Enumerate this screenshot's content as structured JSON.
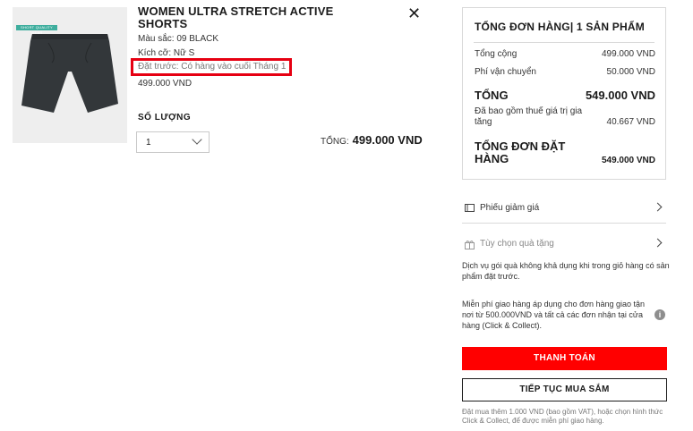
{
  "product": {
    "image_badge": "SHORT QUALITY WEAR",
    "title": "WOMEN ULTRA STRETCH ACTIVE SHORTS",
    "color": "Màu sắc: 09 BLACK",
    "size": "Kích cỡ: Nữ S",
    "preorder": "Đặt trước: Có hàng vào cuối Tháng 1",
    "price": "499.000 VND",
    "qty_label": "SỐ LƯỢNG",
    "qty_value": "1",
    "total_label": "TỔNG:",
    "total_value": "499.000 VND",
    "highlight_color": "#e60012"
  },
  "summary": {
    "heading": "TỔNG ĐƠN HÀNG| 1 SẢN PHẨM",
    "subtotal_label": "Tổng cộng",
    "subtotal_value": "499.000 VND",
    "shipping_label": "Phí vận chuyển",
    "shipping_value": "50.000 VND",
    "total_label": "TỔNG",
    "total_value": "549.000 VND",
    "vat_label": "Đã bao gồm thuế giá trị gia tăng",
    "vat_value": "40.667 VND",
    "order_total_label": "TỔNG ĐƠN ĐẶT HÀNG",
    "order_total_value": "549.000 VND"
  },
  "options": {
    "coupon": "Phiếu giảm giá",
    "gift": "Tùy chọn quà tặng"
  },
  "notes": {
    "gift_note": "Dịch vụ gói quà không khả dụng khi trong giỏ hàng có sản phẩm đặt trước.",
    "shipping_note": "Miễn phí giao hàng áp dụng cho đơn hàng giao tận nơi từ 500.000VND và tất cả các đơn nhận tại cửa hàng (Click & Collect).",
    "footer_note": "Đặt mua thêm 1.000 VND (bao gồm VAT), hoặc chọn hình thức Click & Collect, để được miễn phí giao hàng."
  },
  "buttons": {
    "checkout": "THANH TOÁN",
    "continue": "TIẾP TỤC MUA SẮM"
  },
  "colors": {
    "accent": "#ff0000",
    "border": "#d9d9d9"
  }
}
